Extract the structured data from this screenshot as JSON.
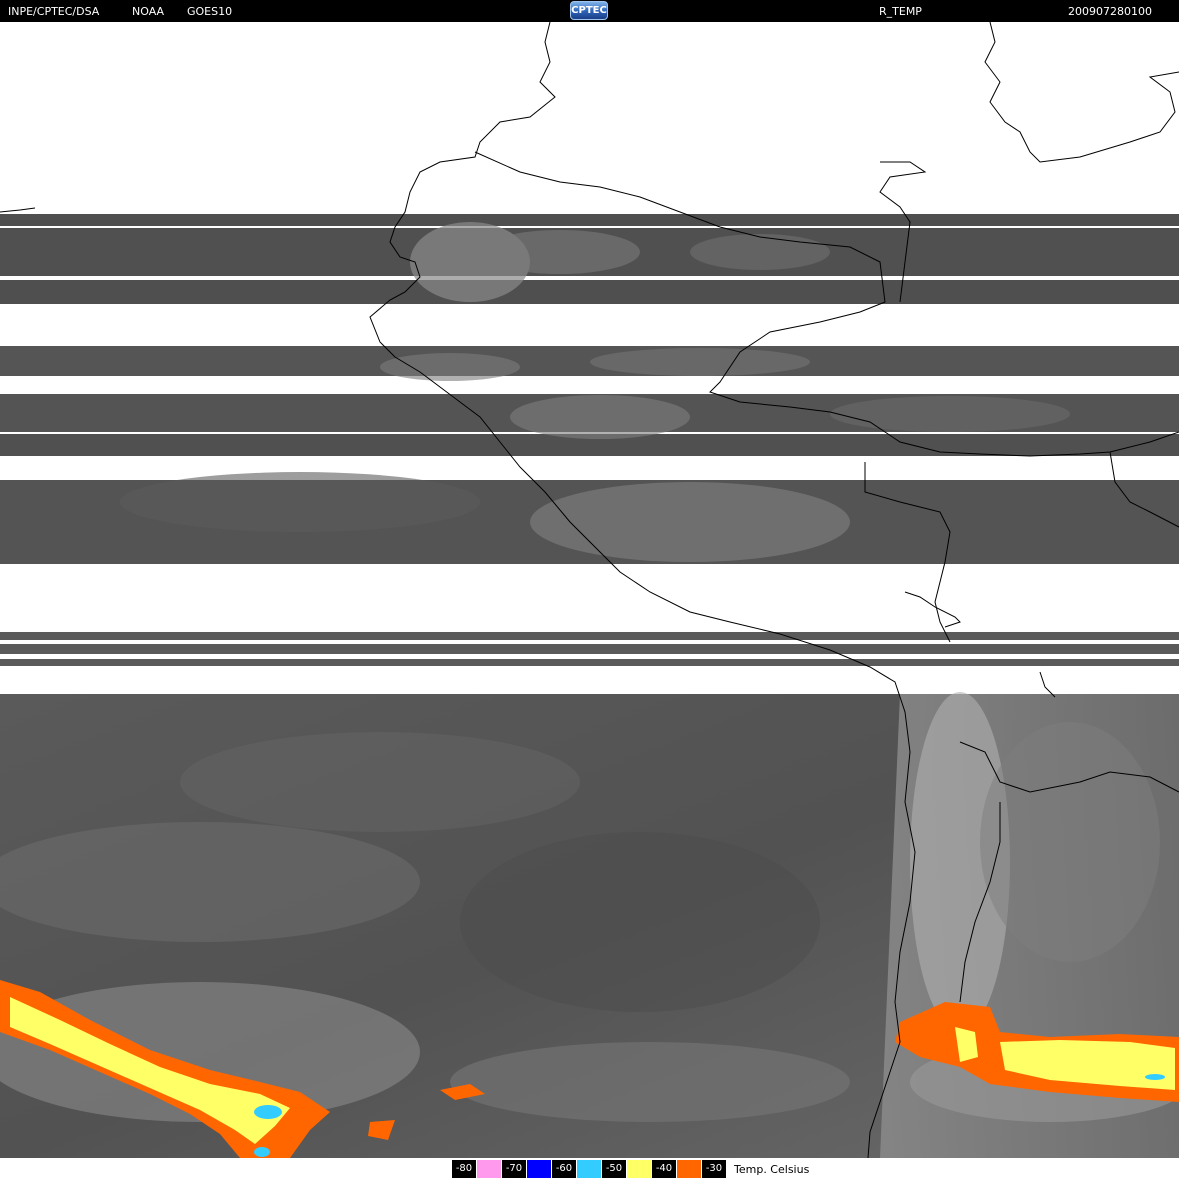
{
  "header": {
    "institution": "INPE/CPTEC/DSA",
    "agency": "NOAA",
    "satellite": "GOES10",
    "logo_text": "CPTEC",
    "product": "R_TEMP",
    "timestamp": "200907280100"
  },
  "legend": {
    "caption": "Temp. Celsius",
    "entries": [
      {
        "label": "-80",
        "color": "#ff99ee"
      },
      {
        "label": "-70",
        "color": "#0000ff"
      },
      {
        "label": "-60",
        "color": "#33ccff"
      },
      {
        "label": "-50",
        "color": "#ffff66"
      },
      {
        "label": "-40",
        "color": "#ff6600"
      },
      {
        "label": "-30",
        "color": "#ff6600"
      }
    ]
  },
  "colors": {
    "background": "#ffffff",
    "header_bg": "#000000",
    "cloud_dark": "#4d4d4d",
    "cloud_mid": "#6e6e6e",
    "cloud_light": "#a8a8a8",
    "coastline": "#000000"
  }
}
